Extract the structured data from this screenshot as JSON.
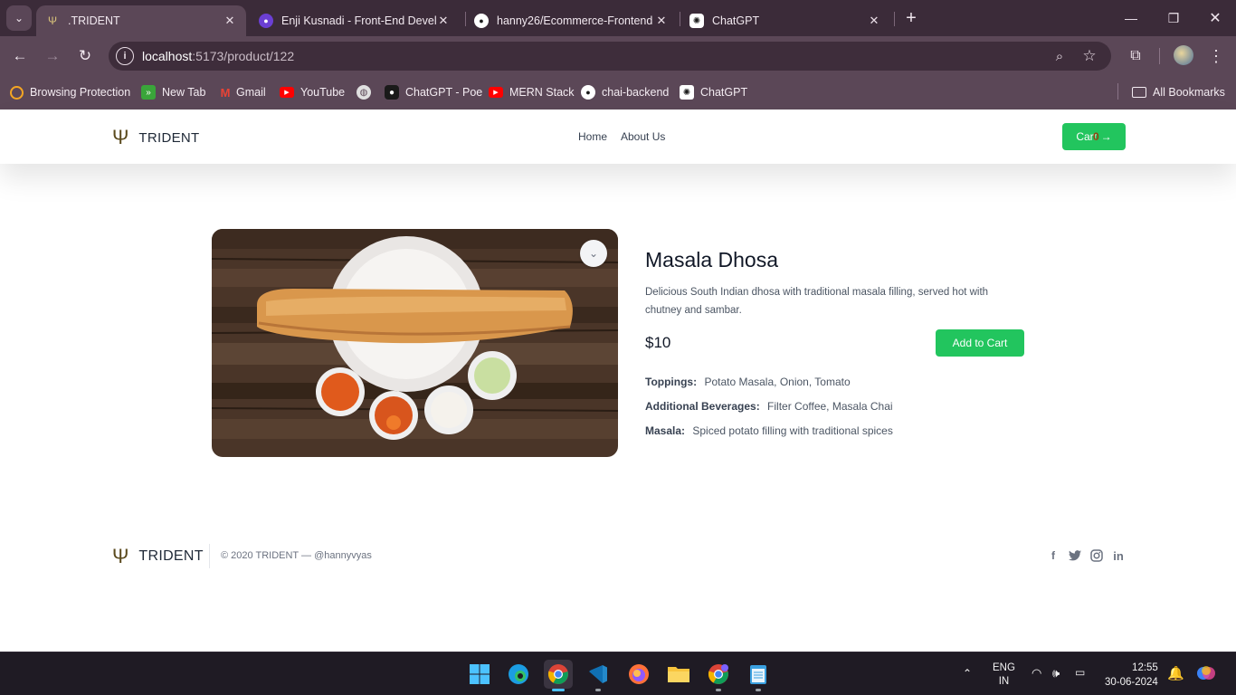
{
  "browser": {
    "tabs": [
      {
        "title": ".TRIDENT",
        "favicon": "trident-icon"
      },
      {
        "title": "Enji Kusnadi - Front-End Develop",
        "favicon": "globe-icon"
      },
      {
        "title": "hanny26/Ecommerce-Frontend",
        "favicon": "github-icon"
      },
      {
        "title": "ChatGPT",
        "favicon": "chatgpt-icon"
      }
    ],
    "url_host": "localhost",
    "url_path": ":5173/product/122",
    "bookmarks": [
      {
        "label": "Browsing Protection",
        "icon": "shield-icon",
        "color": "#f5a623"
      },
      {
        "label": "New Tab",
        "icon": "new-tab-icon",
        "color": "#3aa53a"
      },
      {
        "label": "Gmail",
        "icon": "gmail-icon",
        "color": "#ea4335"
      },
      {
        "label": "YouTube",
        "icon": "youtube-icon",
        "color": "#ff0000"
      },
      {
        "label": "",
        "icon": "globe-icon",
        "color": "#e0e0e0"
      },
      {
        "label": "ChatGPT - Poe",
        "icon": "poe-icon",
        "color": "#1a1a1a"
      },
      {
        "label": "MERN Stack",
        "icon": "youtube-icon",
        "color": "#ff0000"
      },
      {
        "label": "chai-backend",
        "icon": "github-icon",
        "color": "#1a1a1a"
      },
      {
        "label": "ChatGPT",
        "icon": "chatgpt-icon",
        "color": "#1a1a1a"
      }
    ],
    "all_bookmarks": "All Bookmarks"
  },
  "site": {
    "brand": "TRIDENT",
    "nav": [
      "Home",
      "About Us"
    ],
    "cart_label": "Cart",
    "cart_count": "0",
    "cart_arrow": "→",
    "product": {
      "name": "Masala Dhosa",
      "description": "Delicious South Indian dhosa with traditional masala filling, served hot with chutney and sambar.",
      "price": "$10",
      "add_to_cart": "Add to Cart",
      "attributes": [
        {
          "key": "Toppings:",
          "value": "Potato Masala, Onion, Tomato"
        },
        {
          "key": "Additional Beverages:",
          "value": "Filter Coffee, Masala Chai"
        },
        {
          "key": "Masala:",
          "value": "Spiced potato filling with traditional spices"
        }
      ]
    },
    "footer": {
      "brand": "TRIDENT",
      "copyright": "© 2020 TRIDENT — @hannyvyas",
      "social": [
        "facebook-icon",
        "twitter-icon",
        "instagram-icon",
        "linkedin-icon"
      ]
    }
  },
  "taskbar": {
    "lang_top": "ENG",
    "lang_bottom": "IN",
    "time": "12:55",
    "date": "30-06-2024"
  },
  "colors": {
    "accent_green": "#22c55e",
    "chrome_bg": "#5b4757",
    "tabbar_bg": "#3b2b39"
  }
}
